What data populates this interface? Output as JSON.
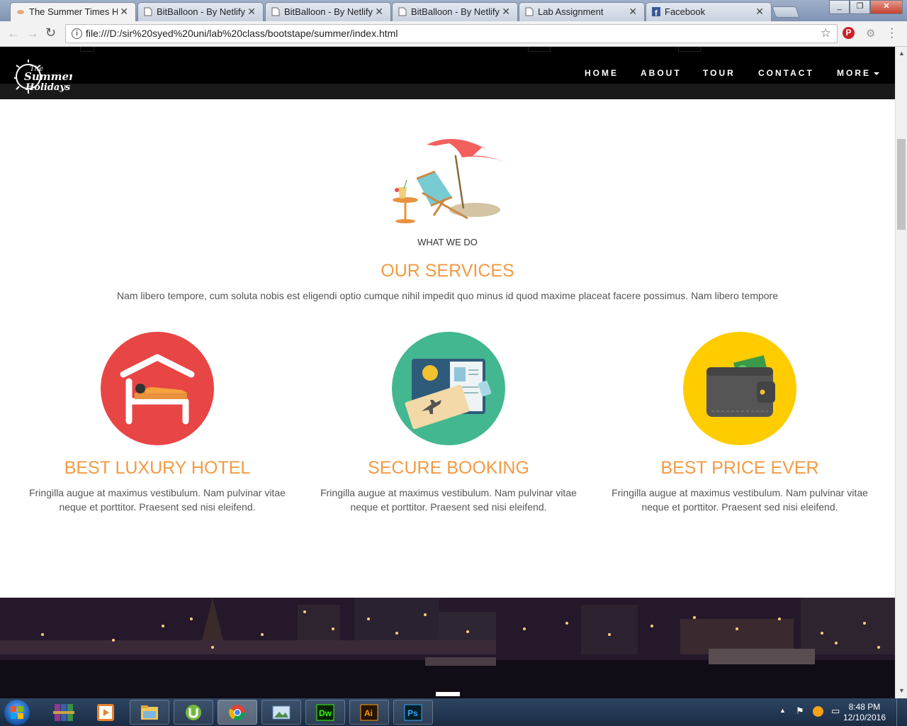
{
  "browser": {
    "tabs": [
      {
        "title": "The Summer Times Ho",
        "active": true
      },
      {
        "title": "BitBalloon - By Netlify",
        "active": false
      },
      {
        "title": "BitBalloon - By Netlify",
        "active": false
      },
      {
        "title": "BitBalloon - By Netlify",
        "active": false
      },
      {
        "title": "Lab Assignment",
        "active": false
      },
      {
        "title": "Facebook",
        "active": false
      }
    ],
    "close_glyph": "✕",
    "url": "file:///D:/sir%20syed%20uni/lab%20class/bootstape/summer/index.html"
  },
  "site": {
    "logo_alt": "The Summer Holidays",
    "nav": [
      "HOME",
      "ABOUT",
      "TOUR",
      "CONTACT",
      "MORE"
    ],
    "section": {
      "kicker": "WHAT WE DO",
      "title": "OUR SERVICES",
      "intro": "Nam libero tempore, cum soluta nobis est eligendi optio cumque nihil impedit quo minus id quod maxime placeat facere possimus. Nam libero tempore"
    },
    "services": [
      {
        "title": "BEST LUXURY HOTEL",
        "icon": "hotel-bed-icon",
        "color": "#e84545",
        "desc": "Fringilla augue at maximus vestibulum. Nam pulvinar vitae neque et porttitor. Praesent sed nisi eleifend."
      },
      {
        "title": "SECURE BOOKING",
        "icon": "passport-ticket-icon",
        "color": "#43b78f",
        "desc": "Fringilla augue at maximus vestibulum. Nam pulvinar vitae neque et porttitor. Praesent sed nisi eleifend."
      },
      {
        "title": "BEST PRICE EVER",
        "icon": "wallet-icon",
        "color": "#ffcc00",
        "desc": "Fringilla augue at maximus vestibulum. Nam pulvinar vitae neque et porttitor. Praesent sed nisi eleifend."
      }
    ],
    "accent_color": "#f49a43"
  },
  "taskbar": {
    "apps": [
      "winrar-icon",
      "media-player-icon",
      "file-explorer-icon",
      "utorrent-icon",
      "chrome-icon",
      "photo-viewer-icon",
      "dreamweaver-icon",
      "illustrator-icon",
      "photoshop-icon"
    ],
    "dw_label": "Dw",
    "ai_label": "Ai",
    "ps_label": "Ps",
    "time": "8:48 PM",
    "date": "12/10/2016"
  }
}
